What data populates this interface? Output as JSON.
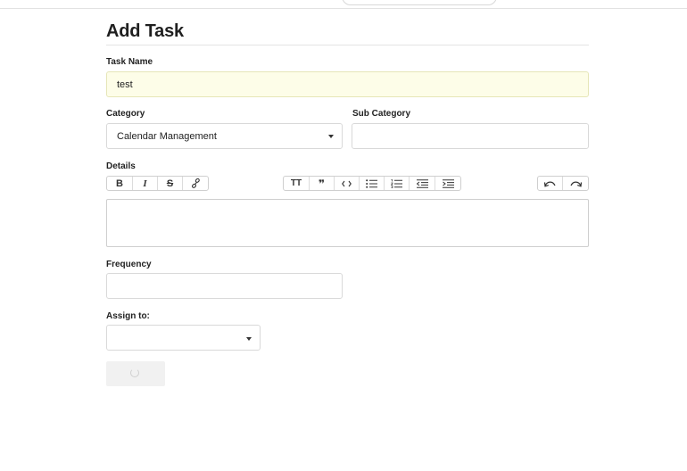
{
  "form": {
    "title": "Add Task",
    "task_name": {
      "label": "Task Name",
      "value": "test"
    },
    "category": {
      "label": "Category",
      "selected": "Calendar Management"
    },
    "sub_category": {
      "label": "Sub Category",
      "value": ""
    },
    "details": {
      "label": "Details",
      "toolbar": {
        "format": [
          "B",
          "I",
          "S",
          "link"
        ],
        "blocks": [
          "heading",
          "quote",
          "code",
          "bulleted-list",
          "numbered-list",
          "outdent",
          "indent"
        ],
        "history": [
          "undo",
          "redo"
        ]
      },
      "value": ""
    },
    "frequency": {
      "label": "Frequency",
      "value": ""
    },
    "assign_to": {
      "label": "Assign to:",
      "selected": ""
    },
    "submit": {
      "state": "loading"
    }
  },
  "icons": {
    "bold": "B",
    "italic": "I",
    "strikethrough": "S",
    "heading": "TT",
    "quote": "❞"
  }
}
